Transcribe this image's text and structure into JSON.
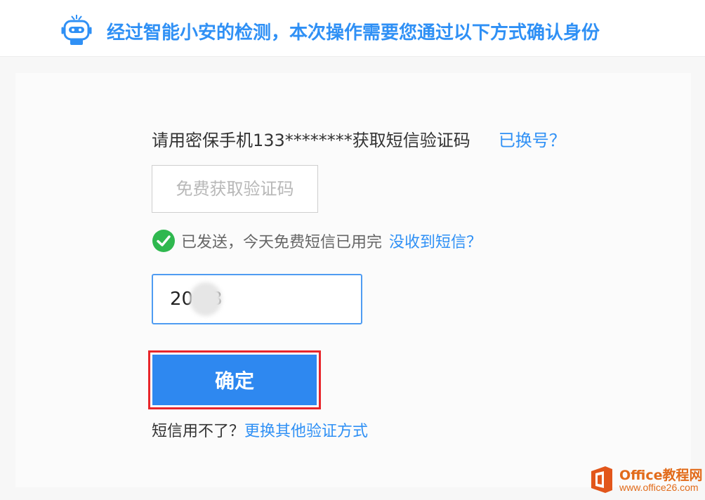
{
  "header": {
    "title": "经过智能小安的检测，本次操作需要您通过以下方式确认身份",
    "robot_icon": "robot-icon"
  },
  "verify": {
    "prompt": "请用密保手机133********获取短信验证码",
    "changed_number_link": "已换号？",
    "get_code_button": "免费获取验证码",
    "status_text": "已发送，今天免费短信已用完",
    "no_sms_link": "没收到短信？",
    "code_value": "20   8",
    "confirm_button": "确定",
    "sms_unavailable_text": "短信用不了？",
    "other_method_link": "更换其他验证方式"
  },
  "watermark": {
    "brand": "Office教程网",
    "url": "www.office26.com"
  },
  "colors": {
    "accent": "#2f90f5",
    "button": "#2e88f0",
    "highlight": "#e8262b",
    "success": "#2fb84f",
    "watermark": "#e26b1a"
  }
}
